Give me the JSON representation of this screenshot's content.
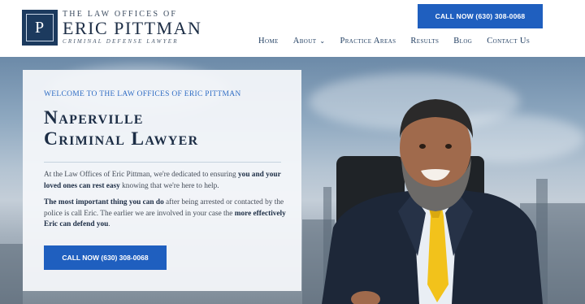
{
  "header": {
    "logo_mark": "P",
    "logo_top": "The Law Offices of",
    "logo_name": "Eric Pittman",
    "logo_sub": "Criminal Defense Lawyer",
    "cta_label": "CALL NOW (630) 308-0068"
  },
  "nav": {
    "items": [
      {
        "label": "Home"
      },
      {
        "label": "About",
        "icon": "chevron-down-icon"
      },
      {
        "label": "Practice Areas"
      },
      {
        "label": "Results"
      },
      {
        "label": "Blog"
      },
      {
        "label": "Contact Us"
      }
    ]
  },
  "hero": {
    "welcome": "WELCOME TO THE LAW OFFICES OF ERIC PITTMAN",
    "headline_line1": "Naperville",
    "headline_line2": "Criminal Lawyer",
    "p1_a": "At the Law Offices of Eric Pittman, we're dedicated to ensuring ",
    "p1_b": "you and your loved ones can rest easy",
    "p1_c": " knowing that we're here to help.",
    "p2_a": "The most important thing you can do",
    "p2_b": " after being arrested or contacted by the police is call Eric. The earlier we are involved in your case the ",
    "p2_c": "more effectively Eric can defend you",
    "p2_d": ".",
    "cta_label": "CALL NOW (630) 308-0068"
  },
  "colors": {
    "brand_navy": "#1c2d45",
    "accent_blue": "#1f5fbf",
    "tie_yellow": "#f2c21b"
  }
}
